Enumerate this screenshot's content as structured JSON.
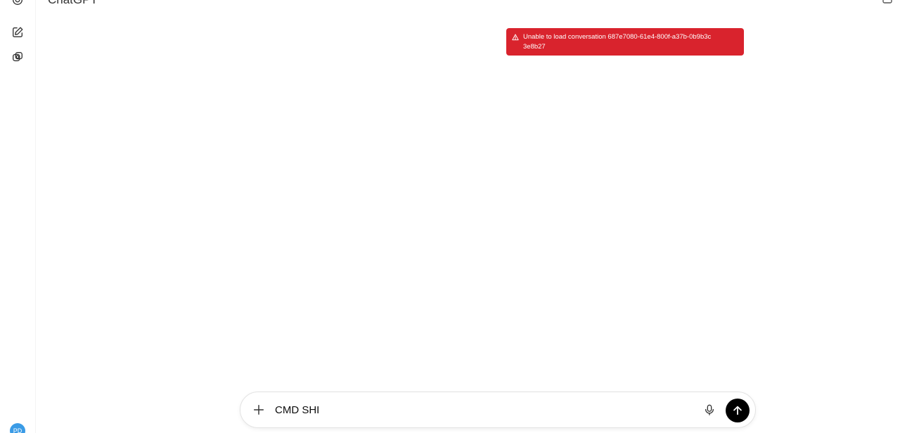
{
  "header": {
    "title": "ChatGPT"
  },
  "sidebar": {
    "icons": [
      "logo-icon",
      "new-chat-icon",
      "gpts-icon"
    ],
    "avatar_initials": "PD",
    "avatar_color": "#3a9be6"
  },
  "toast": {
    "message": "Unable to load conversation 687e7080-61e4-800f-a37b-0b9b3c3e8b27",
    "icon": "warning-icon",
    "color": "#d9232d"
  },
  "composer": {
    "value": "CMD SHI",
    "plus_icon": "plus-icon",
    "mic_icon": "mic-icon",
    "send_icon": "arrow-up-icon"
  }
}
